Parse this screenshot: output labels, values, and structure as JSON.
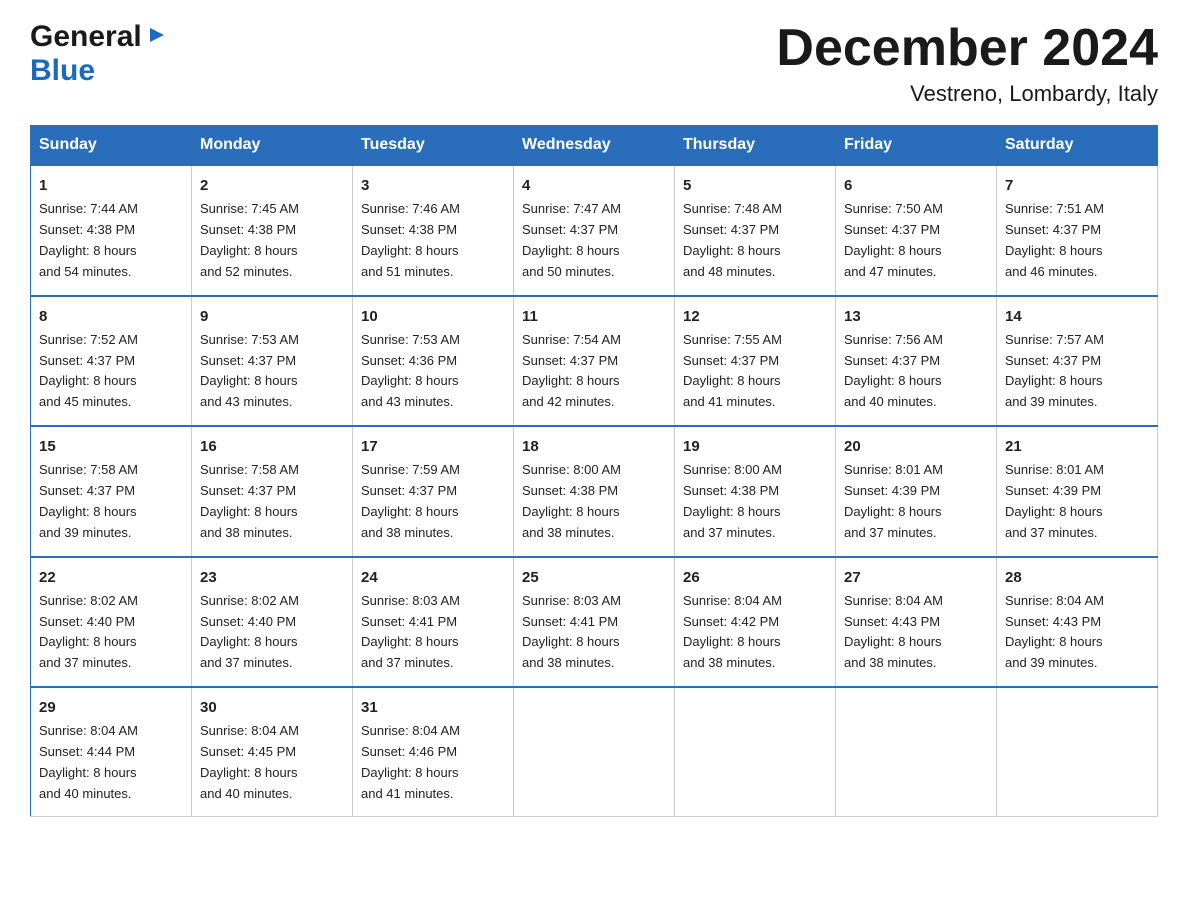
{
  "logo": {
    "general": "General",
    "blue": "Blue"
  },
  "title": "December 2024",
  "subtitle": "Vestreno, Lombardy, Italy",
  "days_of_week": [
    "Sunday",
    "Monday",
    "Tuesday",
    "Wednesday",
    "Thursday",
    "Friday",
    "Saturday"
  ],
  "weeks": [
    [
      {
        "day": "1",
        "sunrise": "7:44 AM",
        "sunset": "4:38 PM",
        "daylight": "8 hours and 54 minutes."
      },
      {
        "day": "2",
        "sunrise": "7:45 AM",
        "sunset": "4:38 PM",
        "daylight": "8 hours and 52 minutes."
      },
      {
        "day": "3",
        "sunrise": "7:46 AM",
        "sunset": "4:38 PM",
        "daylight": "8 hours and 51 minutes."
      },
      {
        "day": "4",
        "sunrise": "7:47 AM",
        "sunset": "4:37 PM",
        "daylight": "8 hours and 50 minutes."
      },
      {
        "day": "5",
        "sunrise": "7:48 AM",
        "sunset": "4:37 PM",
        "daylight": "8 hours and 48 minutes."
      },
      {
        "day": "6",
        "sunrise": "7:50 AM",
        "sunset": "4:37 PM",
        "daylight": "8 hours and 47 minutes."
      },
      {
        "day": "7",
        "sunrise": "7:51 AM",
        "sunset": "4:37 PM",
        "daylight": "8 hours and 46 minutes."
      }
    ],
    [
      {
        "day": "8",
        "sunrise": "7:52 AM",
        "sunset": "4:37 PM",
        "daylight": "8 hours and 45 minutes."
      },
      {
        "day": "9",
        "sunrise": "7:53 AM",
        "sunset": "4:37 PM",
        "daylight": "8 hours and 43 minutes."
      },
      {
        "day": "10",
        "sunrise": "7:53 AM",
        "sunset": "4:36 PM",
        "daylight": "8 hours and 43 minutes."
      },
      {
        "day": "11",
        "sunrise": "7:54 AM",
        "sunset": "4:37 PM",
        "daylight": "8 hours and 42 minutes."
      },
      {
        "day": "12",
        "sunrise": "7:55 AM",
        "sunset": "4:37 PM",
        "daylight": "8 hours and 41 minutes."
      },
      {
        "day": "13",
        "sunrise": "7:56 AM",
        "sunset": "4:37 PM",
        "daylight": "8 hours and 40 minutes."
      },
      {
        "day": "14",
        "sunrise": "7:57 AM",
        "sunset": "4:37 PM",
        "daylight": "8 hours and 39 minutes."
      }
    ],
    [
      {
        "day": "15",
        "sunrise": "7:58 AM",
        "sunset": "4:37 PM",
        "daylight": "8 hours and 39 minutes."
      },
      {
        "day": "16",
        "sunrise": "7:58 AM",
        "sunset": "4:37 PM",
        "daylight": "8 hours and 38 minutes."
      },
      {
        "day": "17",
        "sunrise": "7:59 AM",
        "sunset": "4:37 PM",
        "daylight": "8 hours and 38 minutes."
      },
      {
        "day": "18",
        "sunrise": "8:00 AM",
        "sunset": "4:38 PM",
        "daylight": "8 hours and 38 minutes."
      },
      {
        "day": "19",
        "sunrise": "8:00 AM",
        "sunset": "4:38 PM",
        "daylight": "8 hours and 37 minutes."
      },
      {
        "day": "20",
        "sunrise": "8:01 AM",
        "sunset": "4:39 PM",
        "daylight": "8 hours and 37 minutes."
      },
      {
        "day": "21",
        "sunrise": "8:01 AM",
        "sunset": "4:39 PM",
        "daylight": "8 hours and 37 minutes."
      }
    ],
    [
      {
        "day": "22",
        "sunrise": "8:02 AM",
        "sunset": "4:40 PM",
        "daylight": "8 hours and 37 minutes."
      },
      {
        "day": "23",
        "sunrise": "8:02 AM",
        "sunset": "4:40 PM",
        "daylight": "8 hours and 37 minutes."
      },
      {
        "day": "24",
        "sunrise": "8:03 AM",
        "sunset": "4:41 PM",
        "daylight": "8 hours and 37 minutes."
      },
      {
        "day": "25",
        "sunrise": "8:03 AM",
        "sunset": "4:41 PM",
        "daylight": "8 hours and 38 minutes."
      },
      {
        "day": "26",
        "sunrise": "8:04 AM",
        "sunset": "4:42 PM",
        "daylight": "8 hours and 38 minutes."
      },
      {
        "day": "27",
        "sunrise": "8:04 AM",
        "sunset": "4:43 PM",
        "daylight": "8 hours and 38 minutes."
      },
      {
        "day": "28",
        "sunrise": "8:04 AM",
        "sunset": "4:43 PM",
        "daylight": "8 hours and 39 minutes."
      }
    ],
    [
      {
        "day": "29",
        "sunrise": "8:04 AM",
        "sunset": "4:44 PM",
        "daylight": "8 hours and 40 minutes."
      },
      {
        "day": "30",
        "sunrise": "8:04 AM",
        "sunset": "4:45 PM",
        "daylight": "8 hours and 40 minutes."
      },
      {
        "day": "31",
        "sunrise": "8:04 AM",
        "sunset": "4:46 PM",
        "daylight": "8 hours and 41 minutes."
      },
      null,
      null,
      null,
      null
    ]
  ],
  "labels": {
    "sunrise": "Sunrise:",
    "sunset": "Sunset:",
    "daylight": "Daylight:"
  }
}
